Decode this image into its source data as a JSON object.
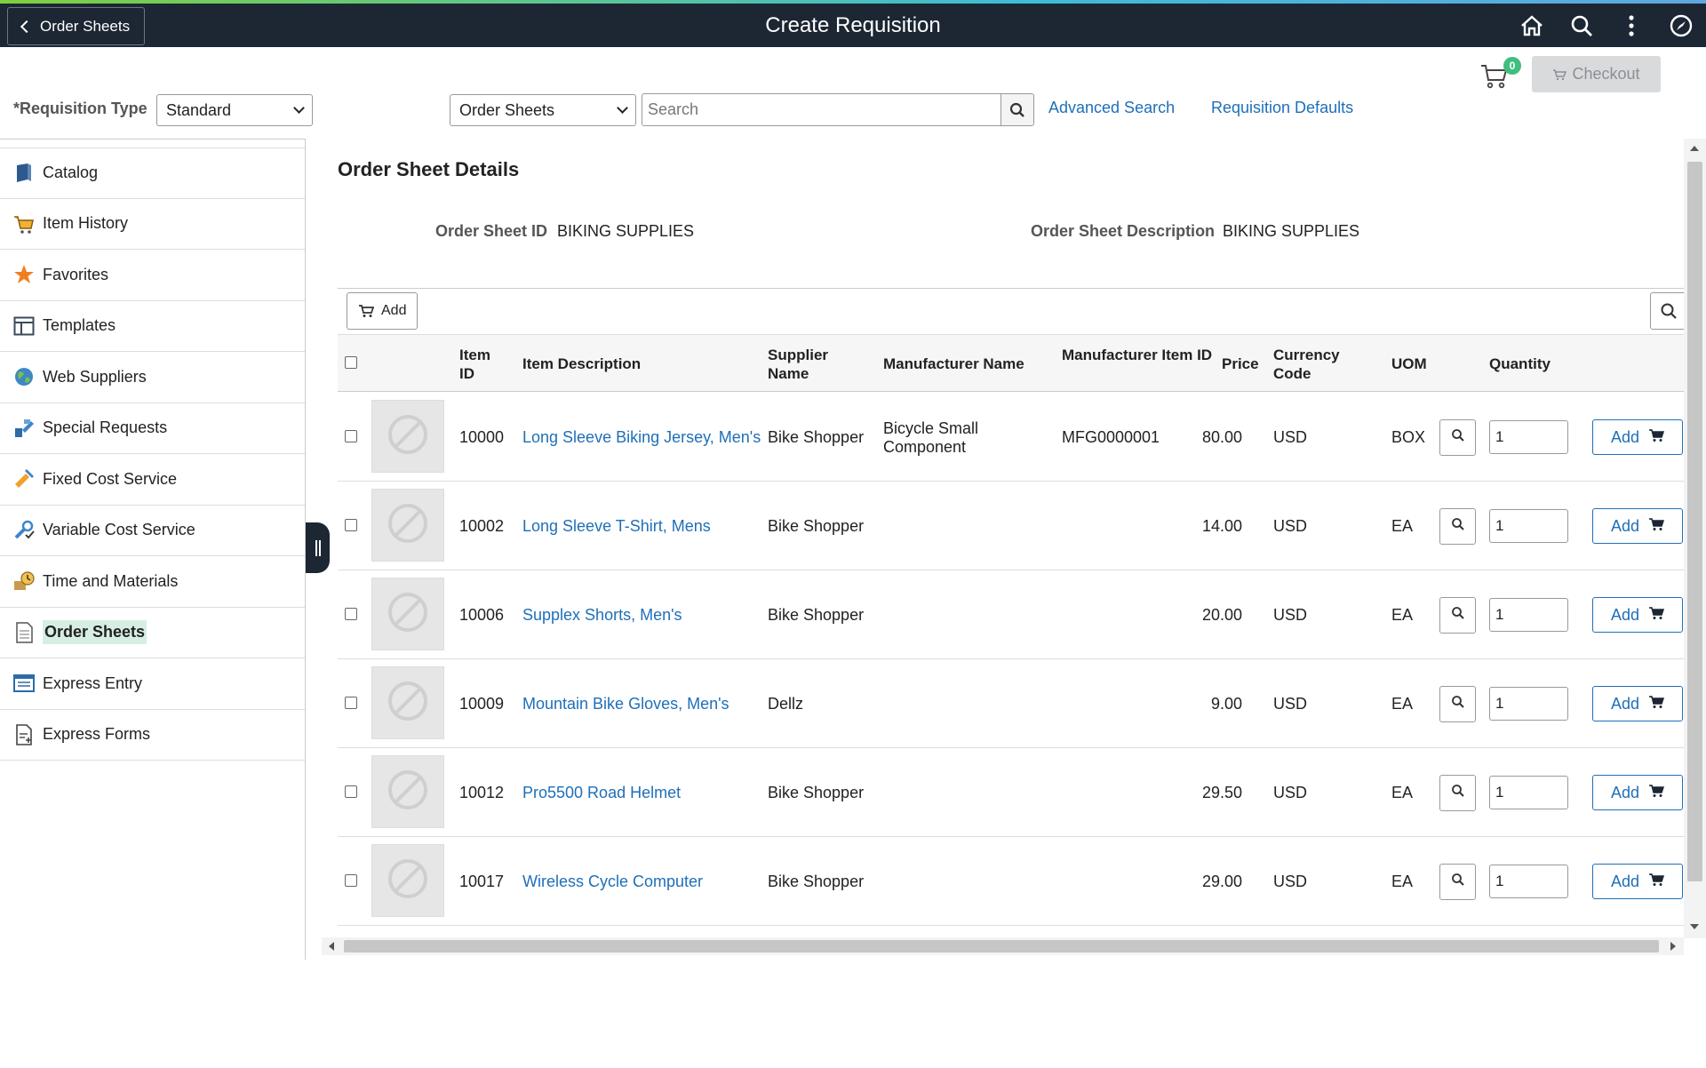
{
  "topbar": {
    "back_label": "Order Sheets",
    "title": "Create Requisition",
    "icons": [
      "home-icon",
      "search-icon",
      "more-vertical-icon",
      "navigator-icon"
    ]
  },
  "header": {
    "cart_count": "0",
    "checkout_label": "Checkout",
    "requisition_type_label": "*Requisition Type",
    "requisition_type_value": "Standard",
    "search_scope_value": "Order Sheets",
    "search_placeholder": "Search",
    "advanced_search_label": "Advanced Search",
    "requisition_defaults_label": "Requisition Defaults"
  },
  "sidebar": {
    "items": [
      {
        "label": "Catalog",
        "icon": "catalog-book-icon"
      },
      {
        "label": "Item History",
        "icon": "cart-history-icon"
      },
      {
        "label": "Favorites",
        "icon": "star-icon"
      },
      {
        "label": "Templates",
        "icon": "template-grid-icon"
      },
      {
        "label": "Web Suppliers",
        "icon": "globe-icon"
      },
      {
        "label": "Special Requests",
        "icon": "special-request-icon"
      },
      {
        "label": "Fixed Cost Service",
        "icon": "fixed-service-icon"
      },
      {
        "label": "Variable Cost Service",
        "icon": "variable-service-icon"
      },
      {
        "label": "Time and Materials",
        "icon": "time-materials-icon"
      },
      {
        "label": "Order Sheets",
        "icon": "order-sheet-icon",
        "active": true
      },
      {
        "label": "Express Entry",
        "icon": "express-entry-icon"
      },
      {
        "label": "Express Forms",
        "icon": "express-forms-icon"
      }
    ]
  },
  "details": {
    "section_title": "Order Sheet Details",
    "order_sheet_id_label": "Order Sheet ID",
    "order_sheet_id_value": "BIKING SUPPLIES",
    "order_sheet_desc_label": "Order Sheet Description",
    "order_sheet_desc_value": "BIKING SUPPLIES"
  },
  "grid": {
    "toolbar_add_label": "Add",
    "columns": {
      "item_id": "Item ID",
      "item_description": "Item Description",
      "supplier_name": "Supplier Name",
      "manufacturer_name": "Manufacturer Name",
      "manufacturer_item_id": "Manufacturer Item ID",
      "price": "Price",
      "currency_code": "Currency Code",
      "uom": "UOM",
      "quantity": "Quantity"
    },
    "add_label": "Add",
    "rows": [
      {
        "item_id": "10000",
        "description": "Long Sleeve Biking Jersey, Men's",
        "supplier": "Bike Shopper",
        "manufacturer": "Bicycle Small Component",
        "mfg_item_id": "MFG0000001",
        "price": "80.00",
        "currency": "USD",
        "uom": "BOX",
        "quantity": "1"
      },
      {
        "item_id": "10002",
        "description": "Long Sleeve T-Shirt, Mens",
        "supplier": "Bike Shopper",
        "manufacturer": "",
        "mfg_item_id": "",
        "price": "14.00",
        "currency": "USD",
        "uom": "EA",
        "quantity": "1"
      },
      {
        "item_id": "10006",
        "description": "Supplex Shorts, Men's",
        "supplier": "Bike Shopper",
        "manufacturer": "",
        "mfg_item_id": "",
        "price": "20.00",
        "currency": "USD",
        "uom": "EA",
        "quantity": "1"
      },
      {
        "item_id": "10009",
        "description": "Mountain Bike Gloves, Men's",
        "supplier": "Dellz",
        "manufacturer": "",
        "mfg_item_id": "",
        "price": "9.00",
        "currency": "USD",
        "uom": "EA",
        "quantity": "1"
      },
      {
        "item_id": "10012",
        "description": "Pro5500 Road Helmet",
        "supplier": "Bike Shopper",
        "manufacturer": "",
        "mfg_item_id": "",
        "price": "29.50",
        "currency": "USD",
        "uom": "EA",
        "quantity": "1"
      },
      {
        "item_id": "10017",
        "description": "Wireless Cycle Computer",
        "supplier": "Bike Shopper",
        "manufacturer": "",
        "mfg_item_id": "",
        "price": "29.00",
        "currency": "USD",
        "uom": "EA",
        "quantity": "1"
      }
    ]
  },
  "colors": {
    "topbar": "#1d2633",
    "link": "#1f6fb8",
    "badge": "#3fbf7f",
    "active_nav": "#d7efe3"
  }
}
